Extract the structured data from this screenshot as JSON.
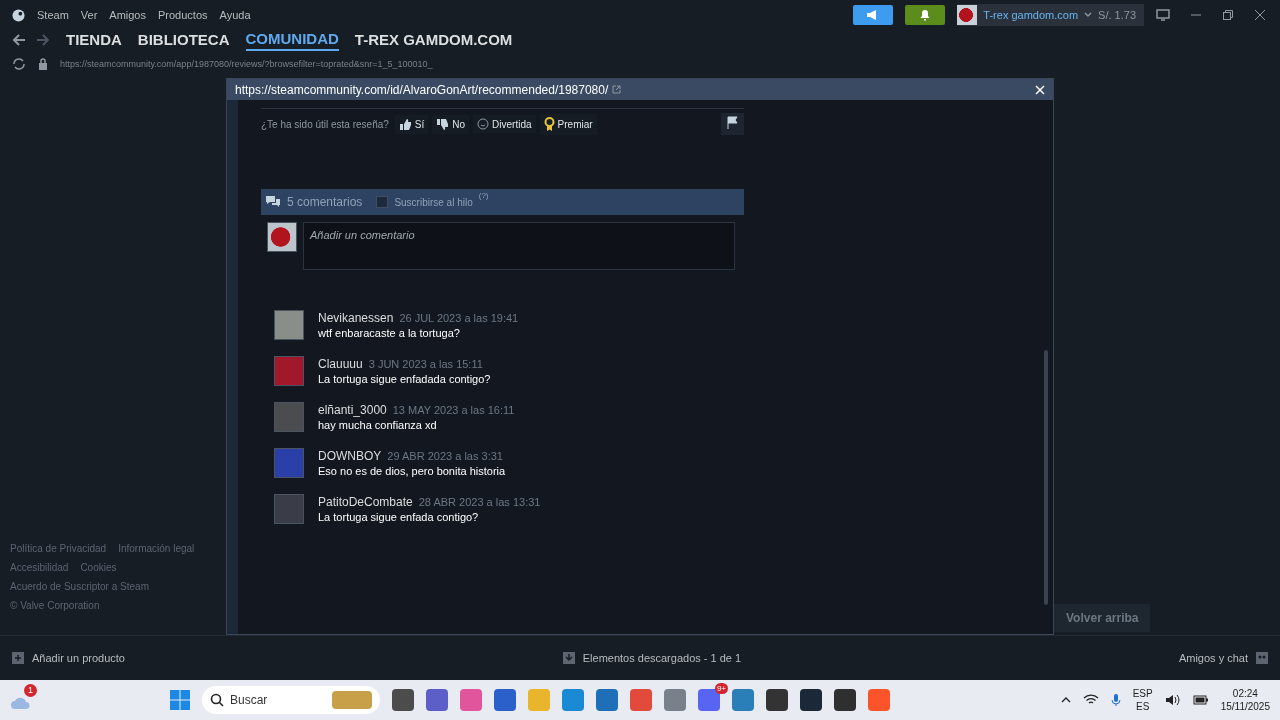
{
  "menu": [
    "Steam",
    "Ver",
    "Amigos",
    "Productos",
    "Ayuda"
  ],
  "nav": [
    {
      "label": "TIENDA",
      "selected": false
    },
    {
      "label": "BIBLIOTECA",
      "selected": false
    },
    {
      "label": "COMUNIDAD",
      "selected": true
    },
    {
      "label": "T-REX GAMDOM.COM",
      "selected": false
    }
  ],
  "account": {
    "name": "T-rex gamdom.com",
    "balance": "S/. 1.73"
  },
  "address": "https://steamcommunity.com/app/1987080/reviews/?browsefilter=toprated&snr=1_5_100010_",
  "footer_links": [
    "Política de Privacidad",
    "Información legal",
    "Accesibilidad",
    "Cookies",
    "Acuerdo de Suscriptor a Steam",
    "© Valve Corporation"
  ],
  "modal": {
    "url": "https://steamcommunity.com/id/AlvaroGonArt/recommended/1987080/",
    "helpful_prompt": "¿Te ha sido útil esta reseña?",
    "votes": [
      {
        "kind": "up",
        "label": "Sí"
      },
      {
        "kind": "down",
        "label": "No"
      },
      {
        "kind": "funny",
        "label": "Divertida"
      },
      {
        "kind": "award",
        "label": "Premiar"
      }
    ],
    "comment_count": "5 comentarios",
    "subscribe": {
      "label": "Suscribirse al hilo",
      "checked": false,
      "hint": "(?)"
    },
    "comment_placeholder": "Añadir un comentario",
    "comments": [
      {
        "author": "Nevikanessen",
        "date": "26 JUL 2023 a las 19:41",
        "text": "wtf enbaracaste a la tortuga?",
        "color": "#8a8e88"
      },
      {
        "author": "Clauuuu",
        "date": "3 JUN 2023 a las 15:11",
        "text": "La tortuga sigue enfadada contigo?",
        "color": "#a0182a"
      },
      {
        "author": "elñanti_3000",
        "date": "13 MAY 2023 a las 16:11",
        "text": "hay mucha confianza xd",
        "color": "#4a4c50"
      },
      {
        "author": "DOWNBOY",
        "date": "29 ABR 2023 a las 3:31",
        "text": "Eso no es de dios, pero bonita historia",
        "color": "#2a3fa8"
      },
      {
        "author": "PatitoDeCombate",
        "date": "28 ABR 2023 a las 13:31",
        "text": "La tortuga sigue enfada contigo?",
        "color": "#3a3d48"
      }
    ]
  },
  "back_to_top": "Volver arriba",
  "bottom_bar": {
    "add": "Añadir un producto",
    "downloads": "Elementos descargados - 1 de 1",
    "friends": "Amigos y chat"
  },
  "taskbar": {
    "weather_badge": "1",
    "search_placeholder": "Buscar",
    "discord_badge": "9+",
    "lang": "ESP",
    "lang2": "ES",
    "time": "02:24",
    "date": "15/11/2025"
  }
}
